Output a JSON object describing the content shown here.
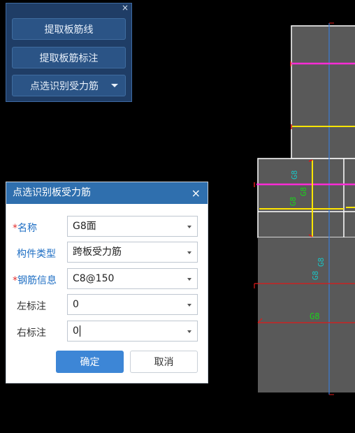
{
  "palette": {
    "buttons": [
      "提取板筋线",
      "提取板筋标注",
      "点选识别受力筋"
    ]
  },
  "dialog": {
    "title": "点选识别板受力筋",
    "close_glyph": "×",
    "fields": {
      "name_label": "名称",
      "name_value": "G8面",
      "type_label": "构件类型",
      "type_value": "跨板受力筋",
      "rebar_label": "钢筋信息",
      "rebar_value": "C8@150",
      "left_label": "左标注",
      "left_value": "0",
      "right_label": "右标注",
      "right_value": "0"
    },
    "required_mark": "*",
    "ok_label": "确定",
    "cancel_label": "取消"
  },
  "drawing": {
    "rebar_labels": [
      "G8",
      "G8",
      "G8",
      "G8",
      "G8",
      "G8"
    ],
    "colors": {
      "background": "#000000",
      "slab": "#595959",
      "outline": "#ffffff",
      "axis": "#3a7bd5",
      "magenta_rebar": "#ff2bd6",
      "yellow_rebar": "#ffe600",
      "red_line": "#e01818",
      "cyan_text": "#19c5c5",
      "green_text": "#19d419"
    }
  }
}
